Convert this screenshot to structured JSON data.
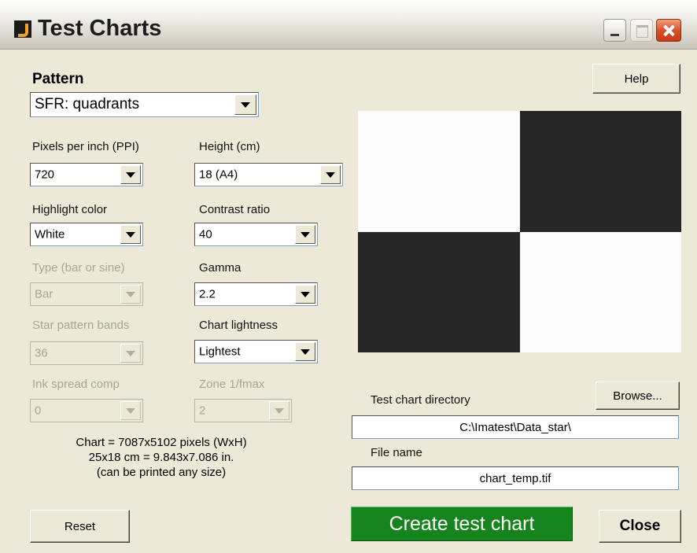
{
  "window": {
    "title": "Test Charts",
    "controls": {
      "minimize": "minimize",
      "maximize": "maximize",
      "close": "close"
    }
  },
  "pattern": {
    "label": "Pattern",
    "value": "SFR: quadrants"
  },
  "fields": {
    "ppi": {
      "label": "Pixels per inch (PPI)",
      "value": "720",
      "enabled": true
    },
    "height": {
      "label": "Height (cm)",
      "value": "18 (A4)",
      "enabled": true
    },
    "highlight_color": {
      "label": "Highlight color",
      "value": "White",
      "enabled": true
    },
    "contrast_ratio": {
      "label": "Contrast ratio",
      "value": "40",
      "enabled": true
    },
    "type": {
      "label": "Type (bar or sine)",
      "value": "Bar",
      "enabled": false
    },
    "gamma": {
      "label": "Gamma",
      "value": "2.2",
      "enabled": true
    },
    "star_bands": {
      "label": "Star pattern bands",
      "value": "36",
      "enabled": false
    },
    "chart_lightness": {
      "label": "Chart lightness",
      "value": "Lightest",
      "enabled": true
    },
    "ink_spread": {
      "label": "Ink spread comp",
      "value": "0",
      "enabled": false
    },
    "zone": {
      "label": "Zone 1/fmax",
      "value": "2",
      "enabled": false
    }
  },
  "chart_info": {
    "line1": "Chart = 7087x5102 pixels (WxH)",
    "line2": "25x18 cm = 9.843x7.086 in.",
    "line3": "(can be printed any size)"
  },
  "buttons": {
    "help": "Help",
    "browse": "Browse...",
    "reset": "Reset",
    "create": "Create test chart",
    "close": "Close"
  },
  "directory": {
    "label": "Test chart directory",
    "value": "C:\\Imatest\\Data_star\\"
  },
  "file_name": {
    "label": "File name",
    "value": "chart_temp.tif"
  },
  "preview": {
    "pattern": "quadrants",
    "dark_color": "#262626",
    "light_color": "#fbfbfb"
  },
  "colors": {
    "window_bg": "#ece9d8",
    "create_button": "#16841d",
    "disabled_text": "#a8a697"
  }
}
